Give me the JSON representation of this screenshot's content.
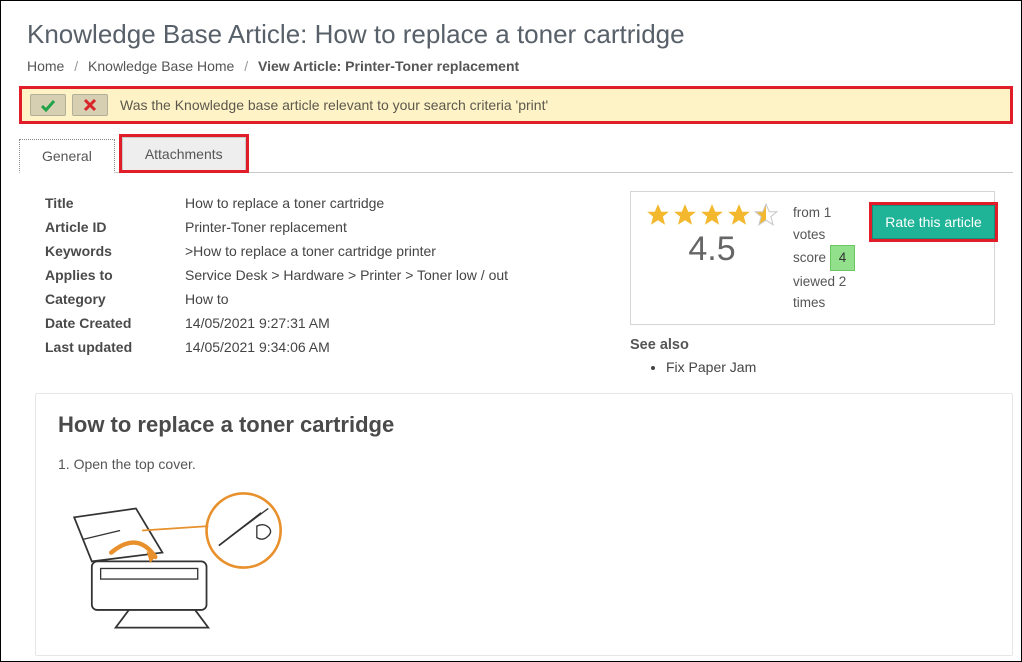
{
  "page_title": "Knowledge Base Article: How to replace a toner cartridge",
  "breadcrumb": {
    "home": "Home",
    "kb_home": "Knowledge Base Home",
    "current": "View Article: Printer-Toner replacement"
  },
  "feedback": {
    "text": "Was the Knowledge base article relevant to your search criteria 'print'"
  },
  "tabs": {
    "general": "General",
    "attachments": "Attachments"
  },
  "meta": {
    "labels": {
      "title": "Title",
      "article_id": "Article ID",
      "keywords": "Keywords",
      "applies_to": "Applies to",
      "category": "Category",
      "date_created": "Date Created",
      "last_updated": "Last updated"
    },
    "values": {
      "title": "How to replace a toner cartridge",
      "article_id": "Printer-Toner replacement",
      "keywords": ">How to replace a toner cartridge printer",
      "applies_to": "Service Desk > Hardware > Printer > Toner low / out",
      "category": "How to",
      "date_created": "14/05/2021 9:27:31 AM",
      "last_updated": "14/05/2021 9:34:06 AM"
    }
  },
  "rating": {
    "score": "4.5",
    "votes_line": "from 1 votes",
    "score_label": "score",
    "score_badge": "4",
    "views_line": "viewed 2 times",
    "rate_button": "Rate this article"
  },
  "see_also": {
    "heading": "See also",
    "items": [
      "Fix Paper Jam"
    ]
  },
  "article": {
    "heading": "How to replace a toner cartridge",
    "step1": "1. Open the top cover."
  }
}
